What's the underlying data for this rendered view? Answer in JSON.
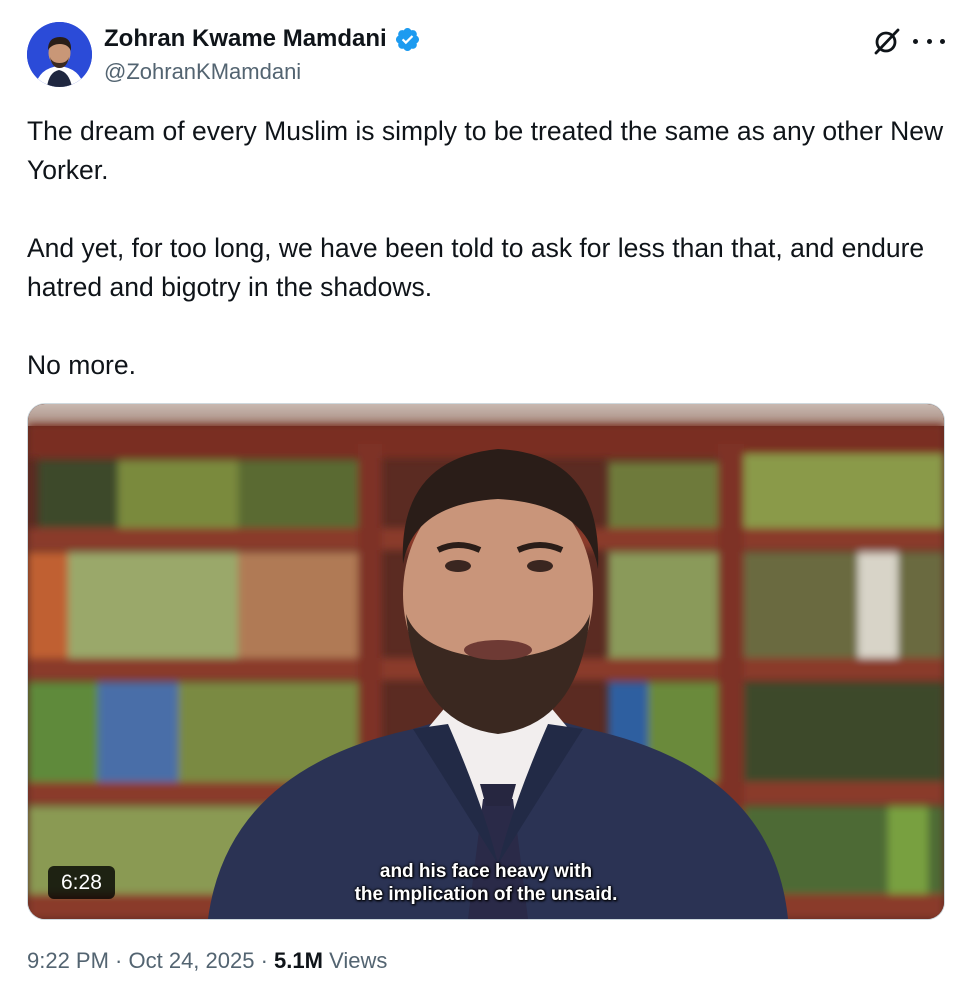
{
  "author": {
    "display_name": "Zohran Kwame Mamdani",
    "handle": "@ZohranKMamdani",
    "verified_icon": "verified-badge-icon"
  },
  "header_icons": [
    "grok-icon",
    "more-options-icon"
  ],
  "tweet": {
    "paragraphs": [
      "The dream of every Muslim is simply to be treated the same as any other New Yorker.",
      "And yet, for too long, we have been told to ask for less than that, and endure hatred and bigotry in the shadows.",
      "No more."
    ]
  },
  "video": {
    "duration": "6:28",
    "subtitle_line1": "and his face heavy with",
    "subtitle_line2": "the implication of the unsaid."
  },
  "meta": {
    "time": "9:22 PM",
    "sep1": " · ",
    "date": "Oct 24, 2025",
    "sep2": " · ",
    "views_count": "5.1M",
    "views_label": " Views"
  },
  "colors": {
    "text": "#0f1419",
    "secondary": "#536471",
    "verified": "#1d9bf0",
    "avatar_bg": "#2b4bd8"
  }
}
